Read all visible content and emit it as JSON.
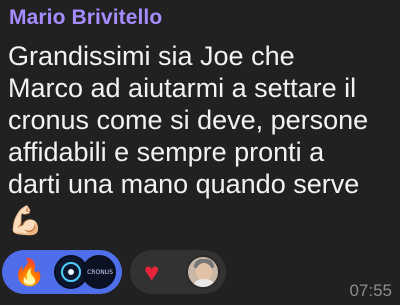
{
  "message": {
    "sender": "Mario Brivitello",
    "text": "Grandissimi sia Joe che\nMarco ad aiutarmi a settare il\ncronus come si deve, persone\naffidabili e sempre pronti a\ndarti una mano quando serve",
    "emoji": "💪🏻",
    "time": "07:55"
  },
  "reactions": [
    {
      "emoji": "🔥",
      "selected": true,
      "color": "#4f6eea",
      "avatars": [
        "avatar-logo-ring",
        "avatar-logo-text"
      ],
      "avatar_text": "CRONUS"
    },
    {
      "emoji": "♥",
      "selected": false,
      "color": "#323232",
      "avatars": [
        "avatar-photo"
      ]
    }
  ],
  "colors": {
    "background": "#212121",
    "sender": "#a58cff",
    "text": "#f2f2f2",
    "time": "#8d8d8d"
  }
}
